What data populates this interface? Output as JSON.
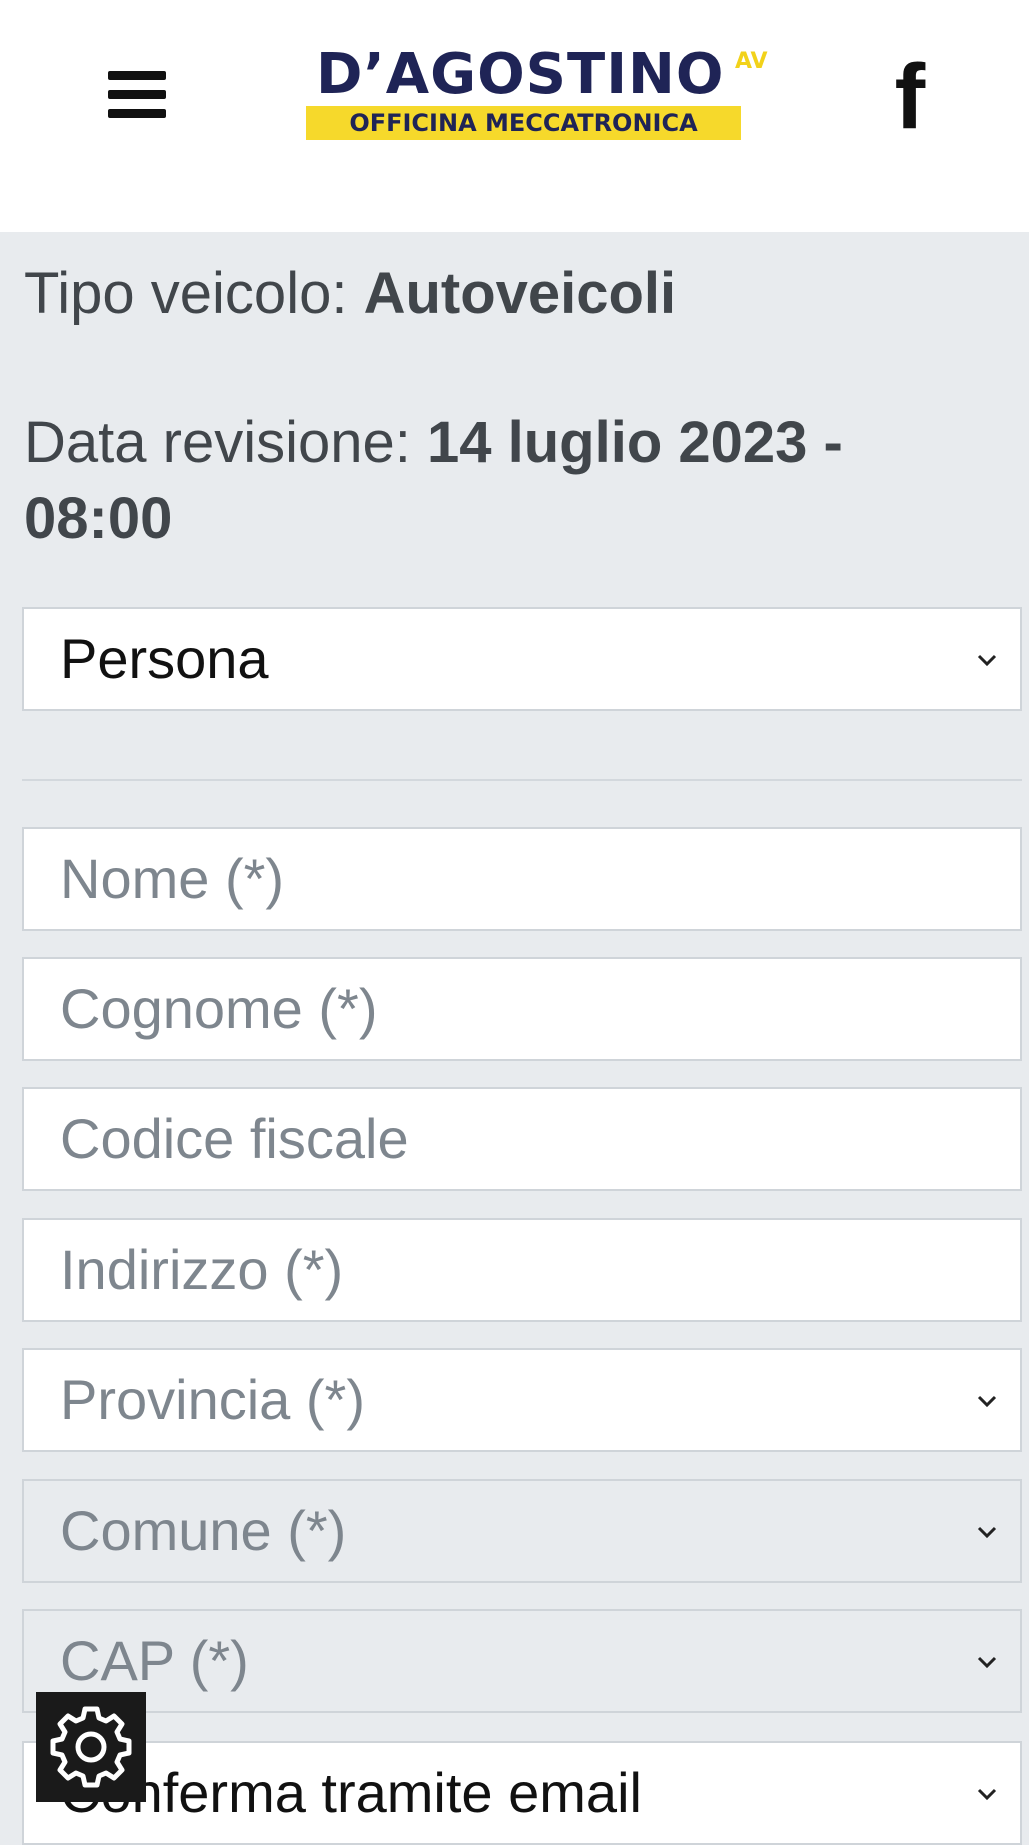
{
  "header": {
    "menu_icon": "hamburger-menu-icon",
    "logo": {
      "name": "D’AGOSTINO",
      "superscript": "AV",
      "tagline": "OFFICINA MECCATRONICA",
      "colors": {
        "navy": "#1f2456",
        "yellow": "#f6d92b"
      }
    },
    "social_icon": "facebook-icon",
    "social_glyph": "f"
  },
  "booking": {
    "vehicle_label": "Tipo veicolo: ",
    "vehicle_value": "Autoveicoli",
    "date_label": "Data revisione: ",
    "date_value": "14 luglio 2023 - 08:00"
  },
  "form": {
    "subject_type": "Persona",
    "nome_placeholder": "Nome (*)",
    "cognome_placeholder": "Cognome (*)",
    "codice_fiscale_placeholder": "Codice fiscale",
    "indirizzo_placeholder": "Indirizzo (*)",
    "provincia_placeholder": "Provincia (*)",
    "comune_placeholder": "Comune (*)",
    "cap_placeholder": "CAP (*)",
    "confirmation_method": "Conferma tramite email"
  },
  "cookie_settings_icon": "gear-icon"
}
